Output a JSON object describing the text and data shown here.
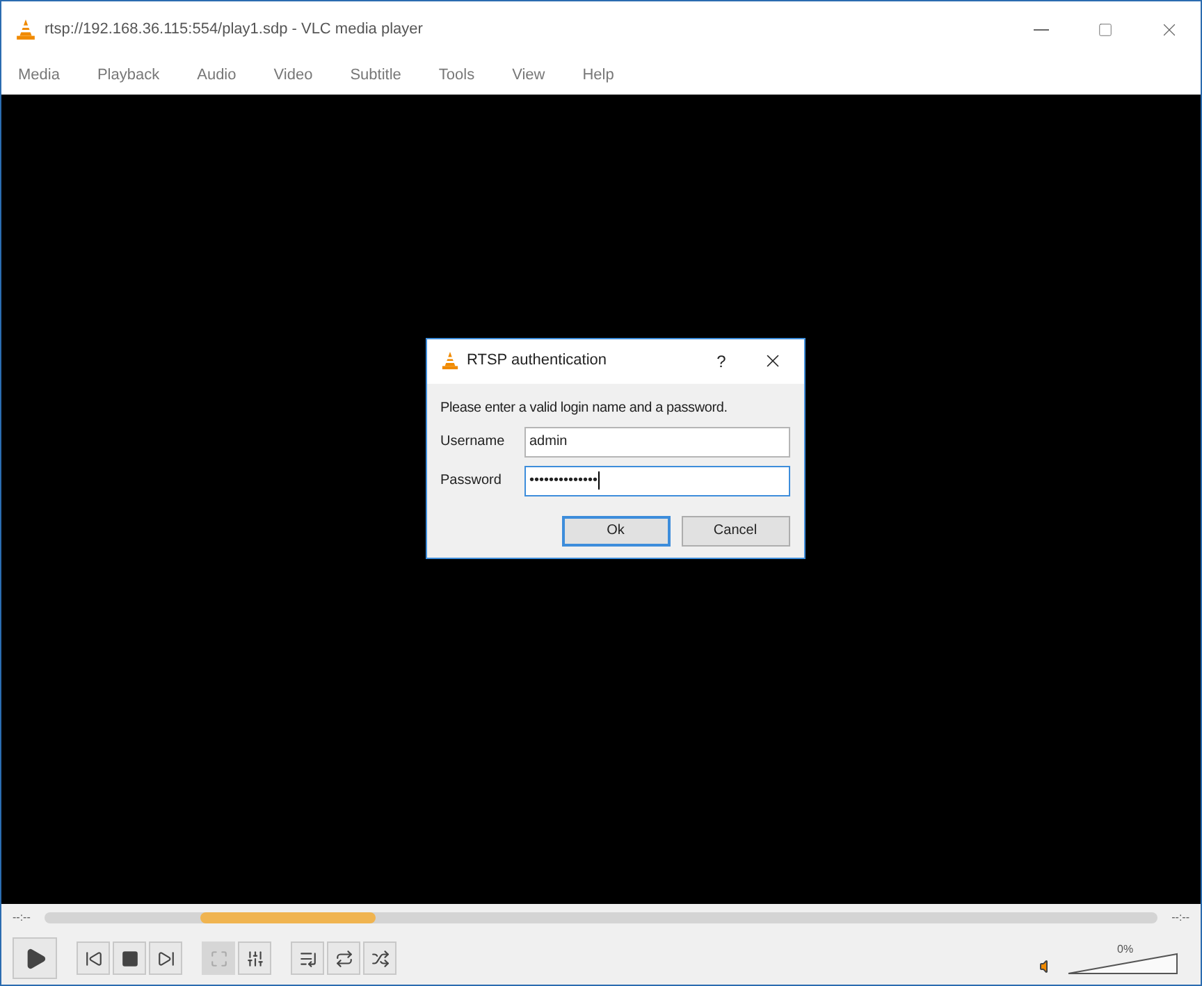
{
  "window": {
    "title": "rtsp://192.168.36.115:554/play1.sdp - VLC media player"
  },
  "menu": [
    "Media",
    "Playback",
    "Audio",
    "Video",
    "Subtitle",
    "Tools",
    "View",
    "Help"
  ],
  "dialog": {
    "title": "RTSP authentication",
    "help": "?",
    "message": "Please enter a valid login name and a password.",
    "fields": [
      {
        "label": "Username",
        "value": "admin",
        "focused": false
      },
      {
        "label": "Password",
        "value": "••••••••••••••",
        "focused": true
      }
    ],
    "buttons": [
      {
        "label": "Ok",
        "default": true
      },
      {
        "label": "Cancel",
        "default": false
      }
    ]
  },
  "seek": {
    "elapsed": "--:--",
    "remaining": "--:--"
  },
  "controls": [
    {
      "kind": "play",
      "disabled": false
    },
    {
      "kind": "previous",
      "disabled": false
    },
    {
      "kind": "stop",
      "disabled": false
    },
    {
      "kind": "next",
      "disabled": false
    },
    {
      "kind": "fullscreen",
      "disabled": true
    },
    {
      "kind": "equalizer",
      "disabled": false
    },
    {
      "kind": "playlist",
      "disabled": false
    },
    {
      "kind": "loop",
      "disabled": false
    },
    {
      "kind": "shuffle",
      "disabled": false
    }
  ],
  "volume": {
    "reading": "0%"
  }
}
